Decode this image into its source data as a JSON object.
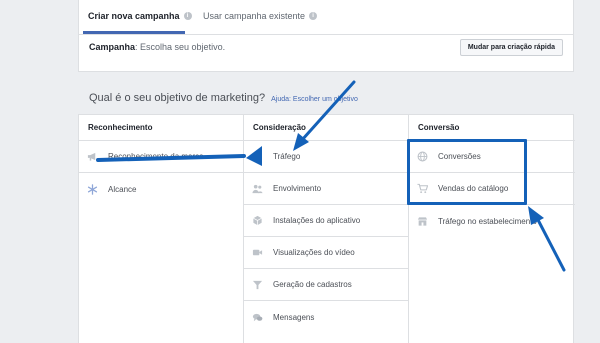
{
  "tabs": [
    {
      "label": "Criar nova campanha",
      "active": true
    },
    {
      "label": "Usar campanha existente",
      "active": false
    }
  ],
  "campaign": {
    "label": "Campanha",
    "text": ": Escolha seu objetivo.",
    "quick_button": "Mudar para criação rápida"
  },
  "question": {
    "text": "Qual é o seu objetivo de marketing?",
    "help": "Ajuda: Escolher um objetivo"
  },
  "columns": [
    {
      "title": "Reconhecimento",
      "items": [
        {
          "label": "Reconhecimento da marca",
          "icon": "megaphone-icon"
        },
        {
          "label": "Alcance",
          "icon": "snowflake-icon"
        }
      ]
    },
    {
      "title": "Consideração",
      "items": [
        {
          "label": "Tráfego",
          "icon": "cursor-icon"
        },
        {
          "label": "Envolvimento",
          "icon": "people-icon"
        },
        {
          "label": "Instalações do aplicativo",
          "icon": "box-icon"
        },
        {
          "label": "Visualizações do vídeo",
          "icon": "video-icon"
        },
        {
          "label": "Geração de cadastros",
          "icon": "funnel-icon"
        },
        {
          "label": "Mensagens",
          "icon": "chat-icon"
        }
      ]
    },
    {
      "title": "Conversão",
      "items": [
        {
          "label": "Conversões",
          "icon": "globe-icon"
        },
        {
          "label": "Vendas do catálogo",
          "icon": "cart-icon"
        },
        {
          "label": "Tráfego no estabelecimento",
          "icon": "store-icon"
        }
      ]
    }
  ],
  "colors": {
    "accent": "#4267b2",
    "annotation": "#1461b8"
  }
}
